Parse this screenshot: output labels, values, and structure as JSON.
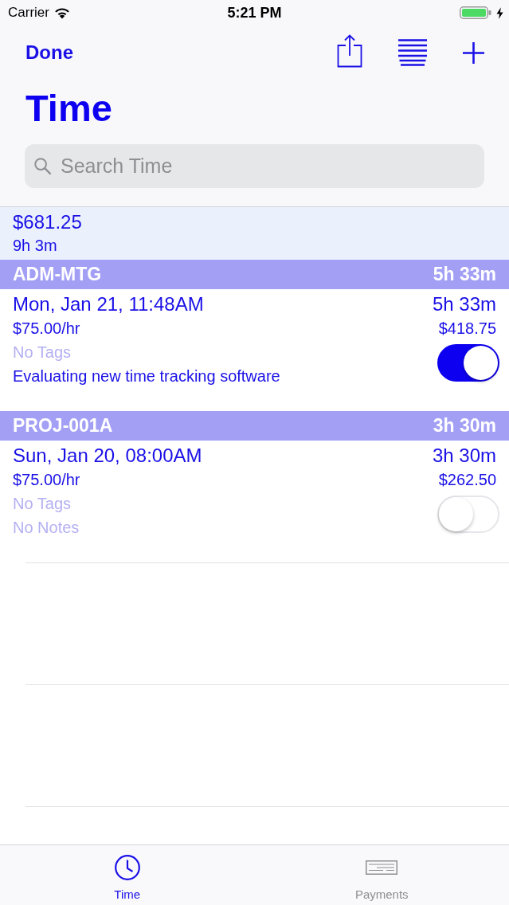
{
  "status_bar": {
    "carrier": "Carrier",
    "time": "5:21 PM"
  },
  "nav_bar": {
    "left_button": "Done",
    "title": "Time"
  },
  "search": {
    "placeholder": "Search Time"
  },
  "summary": {
    "amount": "$681.25",
    "duration": "9h 3m"
  },
  "groups": [
    {
      "name": "ADM-MTG",
      "total": "5h 33m",
      "entries": [
        {
          "date": "Mon, Jan 21, 11:48AM",
          "duration": "5h 33m",
          "rate": "$75.00/hr",
          "amount": "$418.75",
          "tags": "No Tags",
          "tags_empty": true,
          "notes": "Evaluating new time tracking software",
          "notes_empty": false,
          "on": true
        }
      ]
    },
    {
      "name": "PROJ-001A",
      "total": "3h 30m",
      "entries": [
        {
          "date": "Sun, Jan 20, 08:00AM",
          "duration": "3h 30m",
          "rate": "$75.00/hr",
          "amount": "$262.50",
          "tags": "No Tags",
          "tags_empty": true,
          "notes": "No Notes",
          "notes_empty": true,
          "on": false
        }
      ]
    }
  ],
  "tabs": [
    {
      "label": "Time",
      "selected": true,
      "kind": "clock"
    },
    {
      "label": "Payments",
      "selected": false,
      "kind": "card"
    }
  ]
}
